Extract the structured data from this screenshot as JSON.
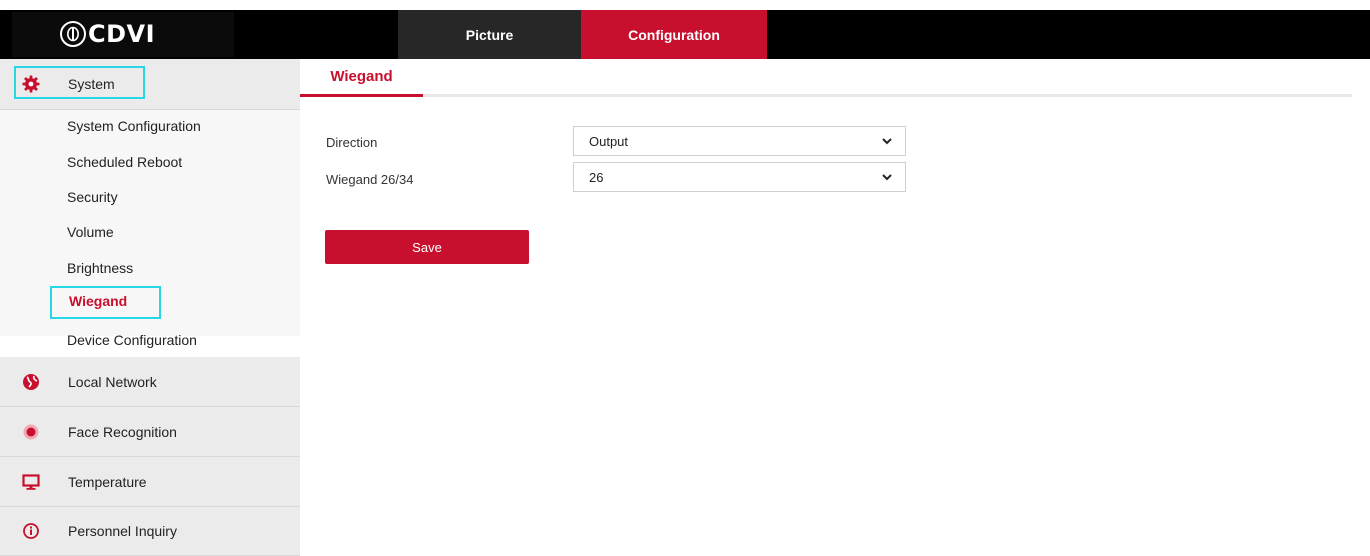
{
  "header": {
    "logo_text": "CDVI",
    "tabs": [
      {
        "label": "Picture"
      },
      {
        "label": "Configuration",
        "active": true
      }
    ]
  },
  "sidebar": {
    "groups": [
      {
        "label": "System",
        "icon": "gear-icon",
        "expanded": true
      },
      {
        "label": "Local Network",
        "icon": "globe-icon"
      },
      {
        "label": "Face Recognition",
        "icon": "face-recognition-icon"
      },
      {
        "label": "Temperature",
        "icon": "monitor-icon"
      },
      {
        "label": "Personnel Inquiry",
        "icon": "info-icon"
      }
    ],
    "system_items": [
      {
        "label": "System Configuration"
      },
      {
        "label": "Scheduled Reboot"
      },
      {
        "label": "Security"
      },
      {
        "label": "Volume"
      },
      {
        "label": "Brightness"
      },
      {
        "label": "Wiegand",
        "active": true
      },
      {
        "label": "Device Configuration"
      }
    ]
  },
  "main": {
    "tab_label": "Wiegand",
    "fields": [
      {
        "label": "Direction",
        "value": "Output"
      },
      {
        "label": "Wiegand 26/34",
        "value": "26"
      }
    ],
    "save_label": "Save"
  },
  "colors": {
    "accent": "#c8102e",
    "highlight": "#28d7e6",
    "topbar": "#000000"
  }
}
